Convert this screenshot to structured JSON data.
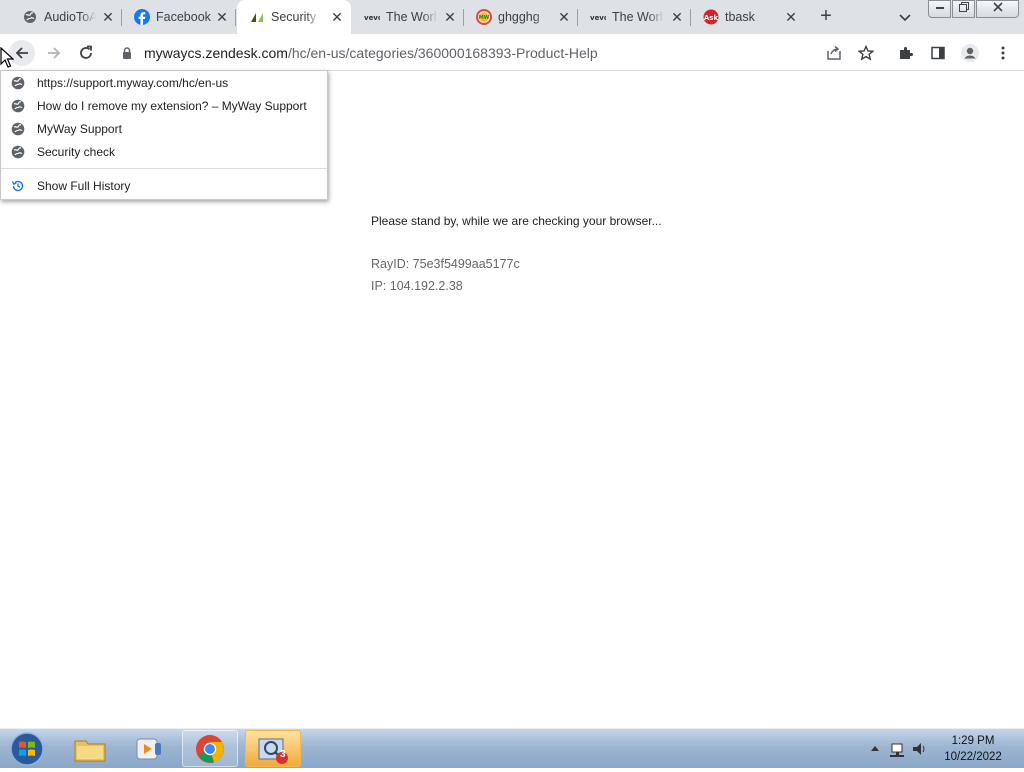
{
  "browser": {
    "tabs": [
      {
        "title": "AudioToA",
        "icon": "globe-icon"
      },
      {
        "title": "Facebook",
        "icon": "facebook-icon"
      },
      {
        "title": "Security c",
        "icon": "zendesk-icon",
        "active": true
      },
      {
        "title": "The Worl",
        "icon": "vevo-icon"
      },
      {
        "title": "ghgghg",
        "icon": "myway-icon"
      },
      {
        "title": "The Worl",
        "icon": "vevo-icon"
      },
      {
        "title": "tbask",
        "icon": "ask-icon"
      }
    ],
    "close_glyph": "✕",
    "new_tab_glyph": "+",
    "address": {
      "host": "mywaycs.zendesk.com",
      "path": "/hc/en-us/categories/360000168393-Product-Help"
    }
  },
  "history_menu": {
    "items": [
      {
        "label": "https://support.myway.com/hc/en-us",
        "icon": "globe-icon"
      },
      {
        "label": "How do I remove my extension? – MyWay Support",
        "icon": "globe-icon"
      },
      {
        "label": "MyWay Support",
        "icon": "globe-icon"
      },
      {
        "label": "Security check",
        "icon": "globe-icon"
      }
    ],
    "full_history_label": "Show Full History"
  },
  "page": {
    "message": "Please stand by, while we are checking your browser...",
    "ray_id": "RayID: 75e3f5499aa5177c",
    "ip": "IP: 104.192.2.38"
  },
  "taskbar": {
    "time": "1:29 PM",
    "date": "10/22/2022",
    "badge": "3"
  },
  "colors": {
    "tabstrip": "#dee1e6",
    "facebook": "#1877f2",
    "chrome_red": "#db4437",
    "chrome_green": "#0f9d58",
    "chrome_yellow": "#f4b400",
    "chrome_blue": "#4285f4"
  }
}
